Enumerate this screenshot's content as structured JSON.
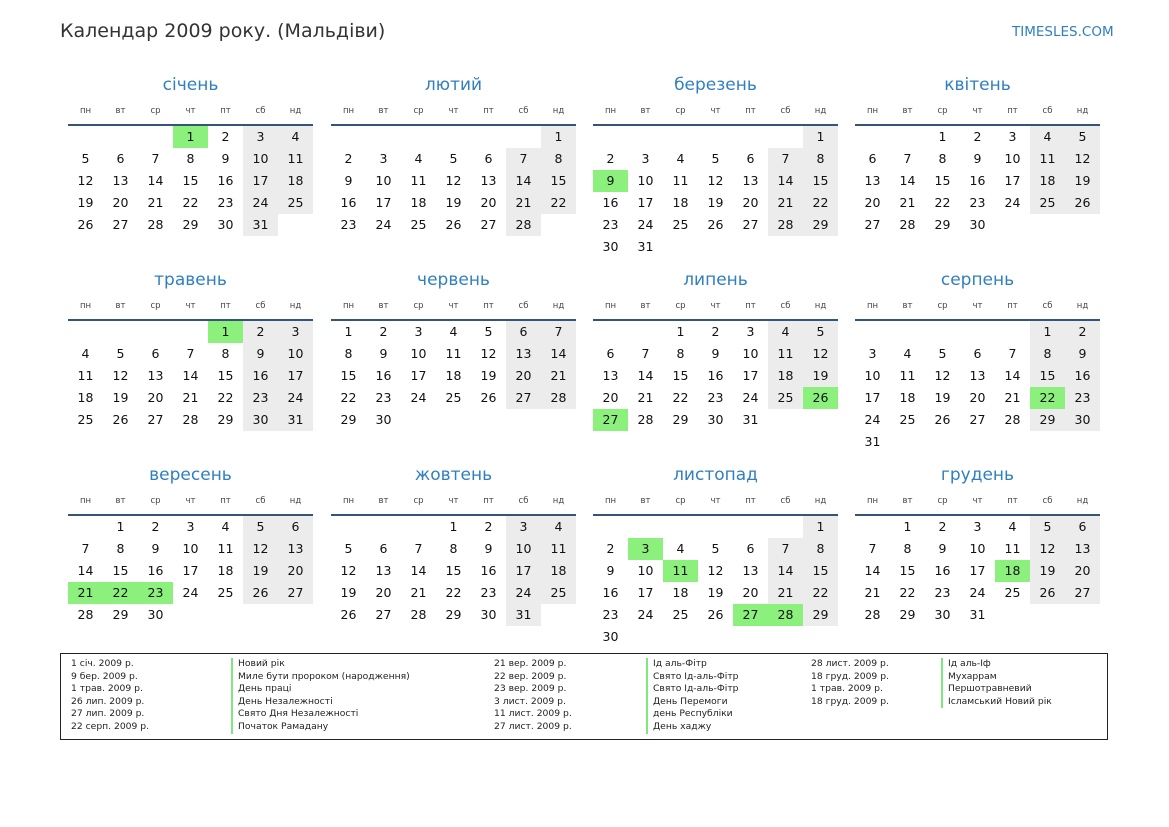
{
  "header": {
    "title": "Календар 2009 року. (Мальдіви)",
    "site": "TIMESLES.COM"
  },
  "weekdays": [
    "пн",
    "вт",
    "ср",
    "чт",
    "пт",
    "сб",
    "нд"
  ],
  "colors": {
    "accent": "#2f7fc1",
    "holiday": "#8cf07c",
    "weekend": "#ececec"
  },
  "months": [
    {
      "name": "січень",
      "offset": 3,
      "days": 31,
      "holidays": [
        1
      ]
    },
    {
      "name": "лютий",
      "offset": 6,
      "days": 28,
      "holidays": []
    },
    {
      "name": "березень",
      "offset": 6,
      "days": 31,
      "holidays": [
        9
      ]
    },
    {
      "name": "квітень",
      "offset": 2,
      "days": 30,
      "holidays": []
    },
    {
      "name": "травень",
      "offset": 4,
      "days": 31,
      "holidays": [
        1
      ]
    },
    {
      "name": "червень",
      "offset": 0,
      "days": 30,
      "holidays": []
    },
    {
      "name": "липень",
      "offset": 2,
      "days": 31,
      "holidays": [
        26,
        27
      ]
    },
    {
      "name": "серпень",
      "offset": 5,
      "days": 31,
      "holidays": [
        22
      ]
    },
    {
      "name": "вересень",
      "offset": 1,
      "days": 30,
      "holidays": [
        21,
        22,
        23
      ]
    },
    {
      "name": "жовтень",
      "offset": 3,
      "days": 31,
      "holidays": []
    },
    {
      "name": "листопад",
      "offset": 6,
      "days": 30,
      "holidays": [
        3,
        11,
        27,
        28
      ]
    },
    {
      "name": "грудень",
      "offset": 1,
      "days": 31,
      "holidays": [
        18
      ]
    }
  ],
  "legend": [
    [
      {
        "date": "1 січ. 2009 р.",
        "name": "Новий рік"
      },
      {
        "date": "9 бер. 2009 р.",
        "name": "Миле бути пророком (народження)"
      },
      {
        "date": "1 трав. 2009 р.",
        "name": "День праці"
      },
      {
        "date": "26 лип. 2009 р.",
        "name": "День Незалежності"
      },
      {
        "date": "27 лип. 2009 р.",
        "name": "Свято Дня Незалежності"
      },
      {
        "date": "22 серп. 2009 р.",
        "name": "Початок Рамадану"
      }
    ],
    [
      {
        "date": "21 вер. 2009 р.",
        "name": "Ід аль-Фітр"
      },
      {
        "date": "22 вер. 2009 р.",
        "name": "Свято Ід-аль-Фітр"
      },
      {
        "date": "23 вер. 2009 р.",
        "name": "Свято Ід-аль-Фітр"
      },
      {
        "date": "3 лист. 2009 р.",
        "name": "День Перемоги"
      },
      {
        "date": "11 лист. 2009 р.",
        "name": "день Республіки"
      },
      {
        "date": "27 лист. 2009 р.",
        "name": "День хаджу"
      }
    ],
    [
      {
        "date": "28 лист. 2009 р.",
        "name": "Ід аль-Іф"
      },
      {
        "date": "18 груд. 2009 р.",
        "name": "Мухаррам"
      },
      {
        "date": "1 трав. 2009 р.",
        "name": "Першотравневий"
      },
      {
        "date": "18 груд. 2009 р.",
        "name": "Ісламський Новий рік"
      }
    ]
  ]
}
